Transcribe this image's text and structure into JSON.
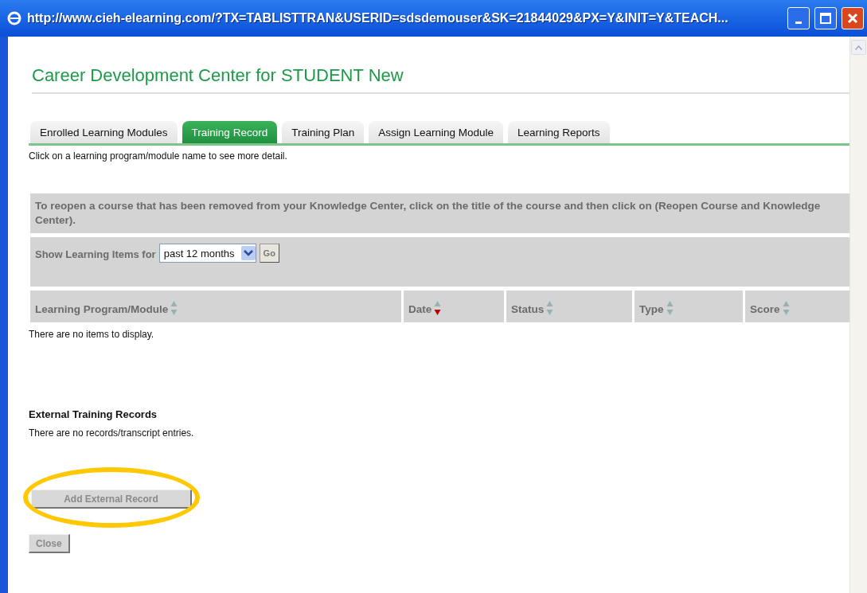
{
  "window": {
    "title": "http://www.cieh-elearning.com/?TX=TABLISTTRAN&USERID=sdsdemouser&SK=21844029&PX=Y&INIT=Y&TEACH..."
  },
  "heading": "Career Development Center for STUDENT New",
  "tabs": [
    {
      "label": "Enrolled Learning Modules",
      "selected": false
    },
    {
      "label": "Training Record",
      "selected": true
    },
    {
      "label": "Training Plan",
      "selected": false
    },
    {
      "label": "Assign Learning Module",
      "selected": false
    },
    {
      "label": "Learning Reports",
      "selected": false
    }
  ],
  "hint": "Click on a learning program/module name to see more detail.",
  "notice": "To reopen a course that has been removed from your Knowledge Center, click on the title of the course and then click on (Reopen Course and Knowledge Center).",
  "filter": {
    "label": "Show Learning Items for",
    "value": "past 12 months",
    "button": "Go"
  },
  "table": {
    "columns": [
      {
        "label": "Learning Program/Module",
        "sorted": false
      },
      {
        "label": "Date",
        "sorted": true
      },
      {
        "label": "Status",
        "sorted": false
      },
      {
        "label": "Type",
        "sorted": false
      },
      {
        "label": "Score",
        "sorted": false
      }
    ],
    "empty": "There are no items to display."
  },
  "external": {
    "title": "External Training Records",
    "empty": "There are no records/transcript entries.",
    "button": "Add External Record",
    "highlighted": true
  },
  "close_button": "Close"
}
